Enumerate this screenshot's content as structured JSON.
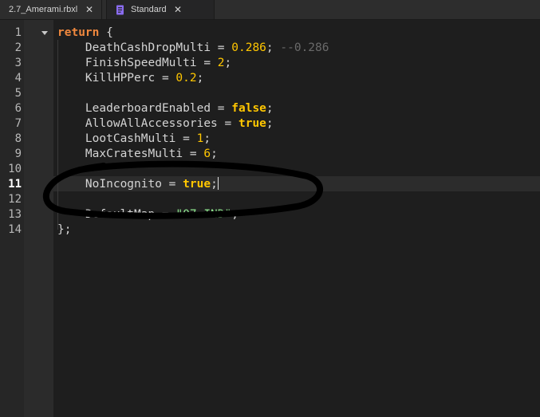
{
  "tabs": [
    {
      "label": "2.7_Amerami.rbxl",
      "close": "✕"
    },
    {
      "label": "Standard",
      "close": "✕"
    }
  ],
  "icons": {
    "script": "script-icon",
    "close": "close-icon",
    "fold": "chevron-down-icon"
  },
  "colors": {
    "keyword": "#f0883e",
    "boolean": "#ffc600",
    "number": "#ffc600",
    "string": "#8de58d",
    "comment": "#6a6a6a",
    "text": "#d4d4d4",
    "annotation": "#000000"
  },
  "editor": {
    "active_line": 11,
    "lines": [
      {
        "n": "1",
        "tokens": [
          {
            "t": "kw",
            "v": "return"
          },
          {
            "t": "p",
            "v": " {"
          }
        ]
      },
      {
        "n": "2",
        "tokens": [
          {
            "t": "p",
            "v": "    DeathCashDropMulti = "
          },
          {
            "t": "num",
            "v": "0.286"
          },
          {
            "t": "p",
            "v": "; "
          },
          {
            "t": "cmt",
            "v": "--0.286"
          }
        ]
      },
      {
        "n": "3",
        "tokens": [
          {
            "t": "p",
            "v": "    FinishSpeedMulti = "
          },
          {
            "t": "num",
            "v": "2"
          },
          {
            "t": "p",
            "v": ";"
          }
        ]
      },
      {
        "n": "4",
        "tokens": [
          {
            "t": "p",
            "v": "    KillHPPerc = "
          },
          {
            "t": "num",
            "v": "0.2"
          },
          {
            "t": "p",
            "v": ";"
          }
        ]
      },
      {
        "n": "5",
        "tokens": []
      },
      {
        "n": "6",
        "tokens": [
          {
            "t": "p",
            "v": "    LeaderboardEnabled = "
          },
          {
            "t": "bool",
            "v": "false"
          },
          {
            "t": "p",
            "v": ";"
          }
        ]
      },
      {
        "n": "7",
        "tokens": [
          {
            "t": "p",
            "v": "    AllowAllAccessories = "
          },
          {
            "t": "bool",
            "v": "true"
          },
          {
            "t": "p",
            "v": ";"
          }
        ]
      },
      {
        "n": "8",
        "tokens": [
          {
            "t": "p",
            "v": "    LootCashMulti = "
          },
          {
            "t": "num",
            "v": "1"
          },
          {
            "t": "p",
            "v": ";"
          }
        ]
      },
      {
        "n": "9",
        "tokens": [
          {
            "t": "p",
            "v": "    MaxCratesMulti = "
          },
          {
            "t": "num",
            "v": "6"
          },
          {
            "t": "p",
            "v": ";"
          }
        ]
      },
      {
        "n": "10",
        "tokens": []
      },
      {
        "n": "11",
        "tokens": [
          {
            "t": "p",
            "v": "    NoIncognito = "
          },
          {
            "t": "bool",
            "v": "true"
          },
          {
            "t": "p",
            "v": ";"
          }
        ]
      },
      {
        "n": "12",
        "tokens": []
      },
      {
        "n": "13",
        "tokens": [
          {
            "t": "p",
            "v": "    DefaultMap = "
          },
          {
            "t": "str",
            "v": "\"07-IND\""
          },
          {
            "t": "p",
            "v": ";"
          }
        ]
      },
      {
        "n": "14",
        "tokens": [
          {
            "t": "p",
            "v": "};"
          }
        ]
      }
    ]
  }
}
